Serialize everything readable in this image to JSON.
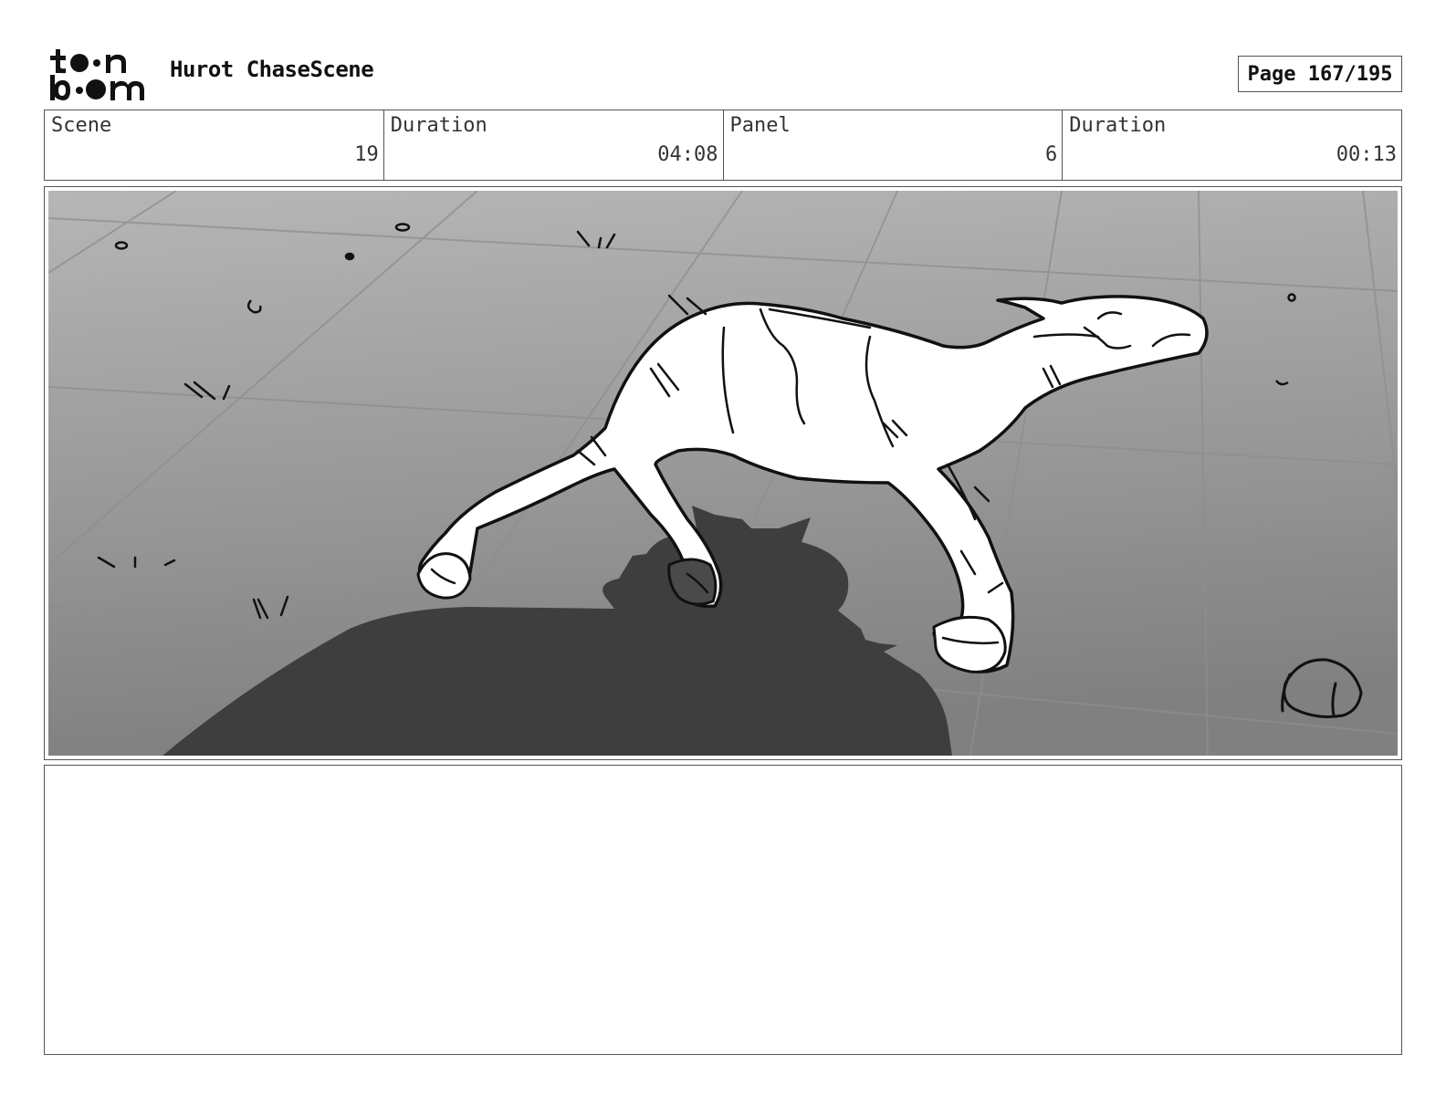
{
  "header": {
    "logo": {
      "line1": "toon",
      "line2": "boom"
    },
    "project_title": "Hurot ChaseScene",
    "page_label": "Page 167/195"
  },
  "info": {
    "scene_label": "Scene",
    "scene_value": "19",
    "scene_duration_label": "Duration",
    "scene_duration_value": "04:08",
    "panel_label": "Panel",
    "panel_value": "6",
    "panel_duration_label": "Duration",
    "panel_duration_value": "00:13"
  },
  "notes": {
    "text": ""
  },
  "colors": {
    "sky_light": "#b4b4b4",
    "ground_dark": "#868686",
    "shadow": "#3e3e3e",
    "line": "#111111"
  }
}
